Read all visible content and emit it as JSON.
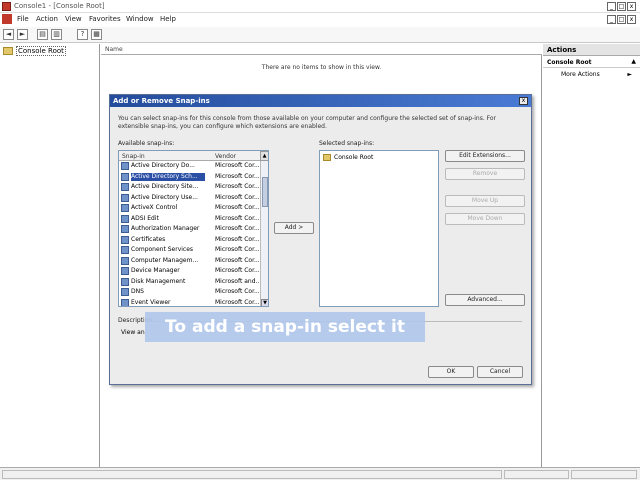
{
  "window": {
    "title": "Console1 - [Console Root]",
    "controls": [
      "_",
      "□",
      "x"
    ]
  },
  "menubar": {
    "items": [
      "File",
      "Action",
      "View",
      "Favorites",
      "Window",
      "Help"
    ],
    "mdi_controls": [
      "_",
      "□",
      "x"
    ]
  },
  "toolbar": {
    "buttons": [
      "◄",
      "►",
      "▤",
      "▥",
      "?",
      "▦"
    ]
  },
  "tree": {
    "root": "Console Root"
  },
  "center": {
    "column_name": "Name",
    "empty_message": "There are no items to show in this view."
  },
  "actions": {
    "header": "Actions",
    "section": "Console Root",
    "more": "More Actions",
    "section_arrow": "▲",
    "more_arrow": "►"
  },
  "dialog": {
    "title": "Add or Remove Snap-ins",
    "close": "x",
    "description": "You can select snap-ins for this console from those available on your computer and configure the selected set of snap-ins. For extensible snap-ins, you can configure which extensions are enabled.",
    "available_label": "Available snap-ins:",
    "col_snapin": "Snap-in",
    "col_vendor": "Vendor",
    "sort_glyph": "▲",
    "scroll_down": "▼",
    "snapins": [
      {
        "name": "Active Directory Do...",
        "vendor": "Microsoft Cor..."
      },
      {
        "name": "Active Directory Sch...",
        "vendor": "Microsoft Cor..."
      },
      {
        "name": "Active Directory Site...",
        "vendor": "Microsoft Cor..."
      },
      {
        "name": "Active Directory Use...",
        "vendor": "Microsoft Cor..."
      },
      {
        "name": "ActiveX Control",
        "vendor": "Microsoft Cor..."
      },
      {
        "name": "ADSI Edit",
        "vendor": "Microsoft Cor..."
      },
      {
        "name": "Authorization Manager",
        "vendor": "Microsoft Cor..."
      },
      {
        "name": "Certificates",
        "vendor": "Microsoft Cor..."
      },
      {
        "name": "Component Services",
        "vendor": "Microsoft Cor..."
      },
      {
        "name": "Computer Managem...",
        "vendor": "Microsoft Cor..."
      },
      {
        "name": "Device Manager",
        "vendor": "Microsoft Cor..."
      },
      {
        "name": "Disk Management",
        "vendor": "Microsoft and..."
      },
      {
        "name": "DNS",
        "vendor": "Microsoft Cor..."
      },
      {
        "name": "Event Viewer",
        "vendor": "Microsoft Cor..."
      }
    ],
    "add_button": "Add >",
    "selected_label": "Selected snap-ins:",
    "selected_root": "Console Root",
    "edit_extensions": "Edit Extensions...",
    "remove": "Remove",
    "move_up": "Move Up",
    "move_down": "Move Down",
    "advanced": "Advanced...",
    "description_label": "Description:",
    "description_text": "View an",
    "ok": "OK",
    "cancel": "Cancel"
  },
  "callout": {
    "text": "To add a snap-in select it"
  }
}
